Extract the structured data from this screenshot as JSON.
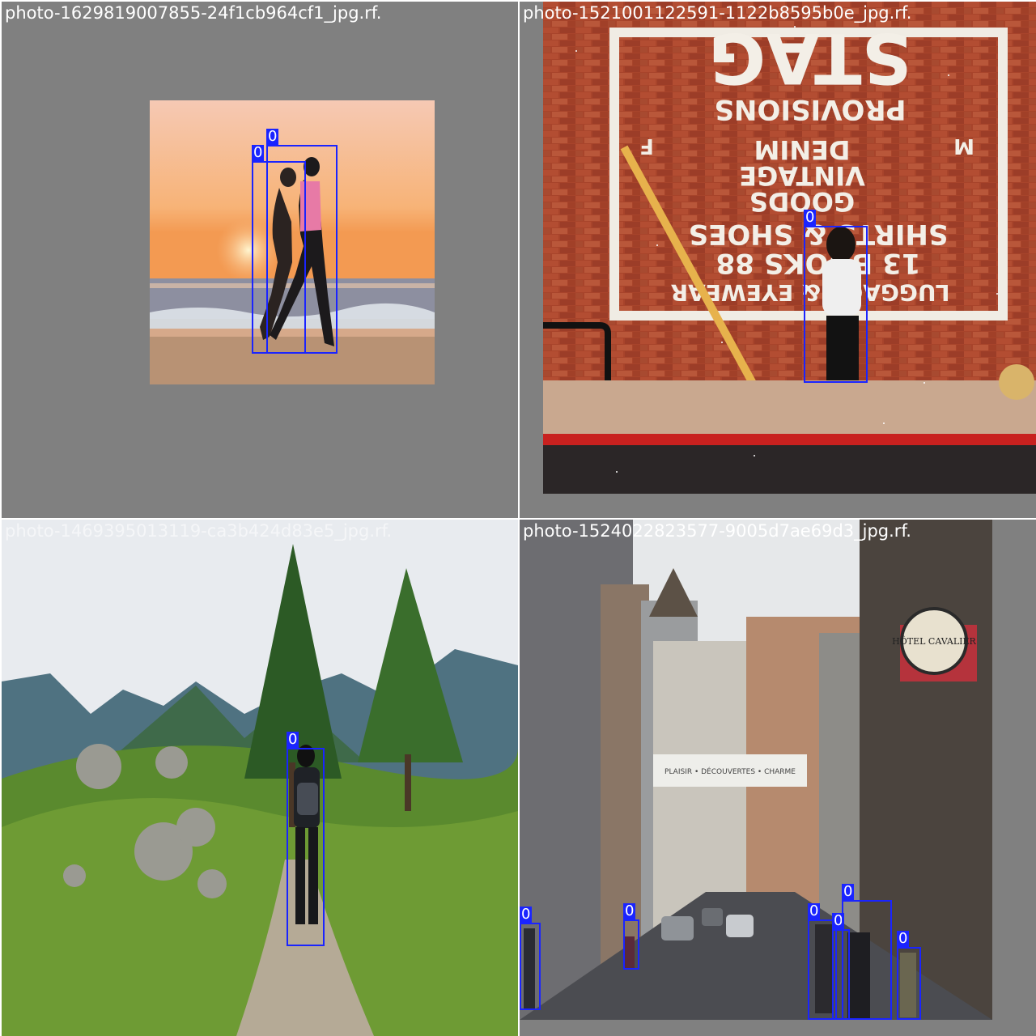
{
  "tiles": [
    {
      "caption": "photo-1629819007855-24f1cb964cf1_jpg.rf.",
      "boxes": [
        {
          "label": "0"
        },
        {
          "label": "0"
        }
      ]
    },
    {
      "caption": "photo-1521001122591-1122b8595b0e_jpg.rf.",
      "boxes": [
        {
          "label": "0"
        }
      ],
      "sign": {
        "title": "STAG",
        "subtitle": "PROVISIONS",
        "lines": [
          "DENIM",
          "VINTAGE",
          "GOODS",
          "SHIRTS & SHOES",
          "13 BOOKS 88",
          "LUGGAGE & EYEWEAR"
        ],
        "side_left": "M",
        "side_right": "F"
      }
    },
    {
      "caption": "photo-1469395013119-ca3b424d83e5_jpg.rf.",
      "boxes": [
        {
          "label": "0"
        }
      ]
    },
    {
      "caption": "photo-1524022823577-9005d7ae69d3_jpg.rf.",
      "boxes": [
        {
          "label": "0"
        },
        {
          "label": "0"
        },
        {
          "label": "0"
        },
        {
          "label": "0"
        },
        {
          "label": "0"
        },
        {
          "label": "0"
        }
      ],
      "banner": "PLAISIR • DÉCOUVERTES • CHARME",
      "hotel": "HÔTEL CAVALIER"
    }
  ],
  "colors": {
    "box": "#1a24ff",
    "pad": "#808080"
  }
}
